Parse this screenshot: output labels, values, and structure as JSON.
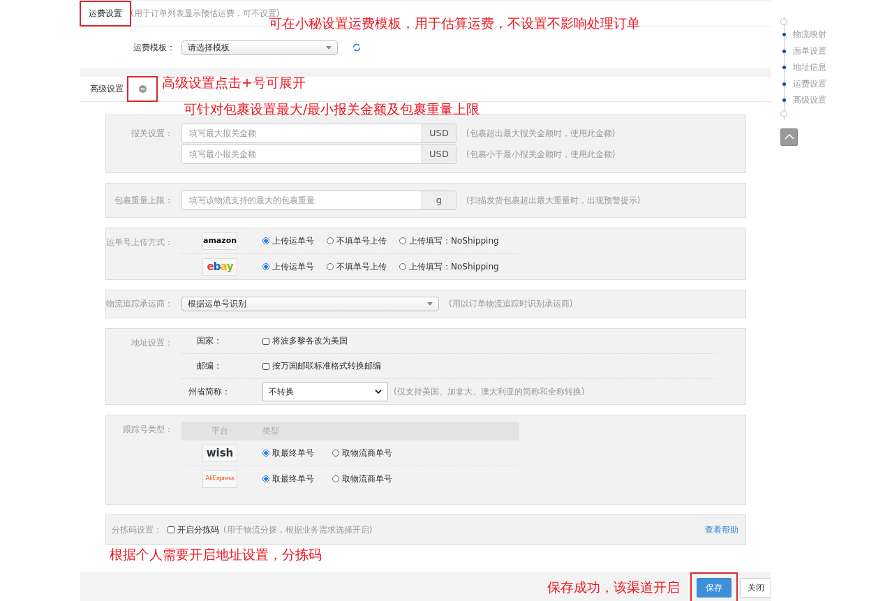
{
  "freight": {
    "title": "运费设置",
    "highlighted": true,
    "hint": "(用于订单列表显示预估运费，可不设置)",
    "annotation": "可在小秘设置运费模板，用于估算运费，不设置不影响处理订单",
    "template_label": "运费模板：",
    "template_value": "请选择模板"
  },
  "advanced": {
    "title": "高级设置",
    "expanded": true,
    "highlighted": true,
    "annotation": "高级设置点击+号可展开",
    "customs_annotation": "可针对包裹设置最大/最小报关金额及包裹重量上限",
    "customs": {
      "label": "报关设置：",
      "fields": [
        {
          "placeholder": "填写最大报关金额",
          "unit": "USD",
          "note": "(包裹超出最大报关金额时，使用此金额)"
        },
        {
          "placeholder": "填写最小报关金额",
          "unit": "USD",
          "note": "(包裹小于最小报关金额时，使用此金额)"
        }
      ]
    },
    "weight": {
      "label": "包裹重量上限：",
      "placeholder": "填写该物流支持的最大的包裹重量",
      "unit": "g",
      "note": "(扫描发货包裹超出最大重量时，出现预警提示)"
    },
    "upload": {
      "label": "运单号上传方式：",
      "platforms": [
        {
          "logo": "amazon",
          "kind": "amazon",
          "options": [
            {
              "label": "上传运单号",
              "selected": true
            },
            {
              "label": "不填单号上传",
              "selected": false
            },
            {
              "label": "上传填写：NoShipping",
              "selected": false
            }
          ]
        },
        {
          "logo": "ebay",
          "kind": "ebay",
          "options": [
            {
              "label": "上传运单号",
              "selected": true
            },
            {
              "label": "不填单号上传",
              "selected": false
            },
            {
              "label": "上传填写：NoShipping",
              "selected": false
            }
          ]
        }
      ]
    },
    "carrier": {
      "label": "物流追踪承运商：",
      "value": "根据运单号识别",
      "note": "(用以订单物流追踪时识别承运商)"
    },
    "address": {
      "label": "地址设置：",
      "rows": [
        {
          "kind": "checkbox",
          "label": "国家：",
          "option": "将波多黎各改为美国",
          "checked": false
        },
        {
          "kind": "checkbox",
          "label": "邮编：",
          "option": "按万国邮联标准格式转换邮编",
          "checked": false
        },
        {
          "kind": "select",
          "label": "州省简称：",
          "value": "不转换",
          "note": "(仅支持美国、加拿大、澳大利亚的简称和全称转换)"
        }
      ]
    },
    "tracking": {
      "label": "跟踪号类型：",
      "columns": [
        "平台",
        "类型"
      ],
      "platforms": [
        {
          "logo": "wish",
          "kind": "wish",
          "options": [
            {
              "label": "取最终单号",
              "selected": true
            },
            {
              "label": "取物流商单号",
              "selected": false
            }
          ]
        },
        {
          "logo": "AliExpress",
          "kind": "aliexpress",
          "options": [
            {
              "label": "取最终单号",
              "selected": true
            },
            {
              "label": "取物流商单号",
              "selected": false
            }
          ]
        }
      ]
    },
    "sorting": {
      "label": "分拣码设置：",
      "option": "开启分拣码",
      "checked": false,
      "note": "(用于物流分拨，根据业务需求选择开启)",
      "help": "查看帮助"
    },
    "sorting_annotation": "根据个人需要开启地址设置，分拣码"
  },
  "footer": {
    "annotation": "保存成功，该渠道开启",
    "buttons": [
      {
        "label": "保存",
        "kind": "primary",
        "highlighted": true
      },
      {
        "label": "关闭",
        "kind": "default",
        "highlighted": false
      }
    ]
  },
  "side_nav": {
    "items": [
      "物流映射",
      "面单设置",
      "地址信息",
      "运费设置",
      "高级设置"
    ]
  }
}
